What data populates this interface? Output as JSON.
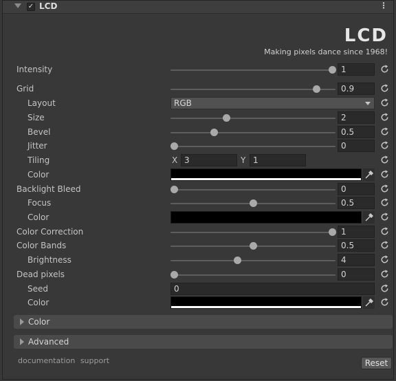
{
  "header": {
    "title": "LCD",
    "enabled_check": "✓",
    "menu_glyph": "⋮"
  },
  "logo": {
    "text": "LCD",
    "tagline": "Making pixels dance since 1968!"
  },
  "rows": [
    {
      "label": "Intensity",
      "value": "1",
      "fraction": 1.0
    },
    {
      "label": "Grid",
      "value": "0.9",
      "fraction": 0.9
    },
    {
      "label": "Layout",
      "value": "RGB"
    },
    {
      "label": "Size",
      "value": "2",
      "fraction": 0.33
    },
    {
      "label": "Bevel",
      "value": "0.5",
      "fraction": 0.25
    },
    {
      "label": "Jitter",
      "value": "0",
      "fraction": 0.0
    },
    {
      "label": "Tiling",
      "x_label": "X",
      "x_value": "3",
      "y_label": "Y",
      "y_value": "1"
    },
    {
      "label": "Color",
      "color": "#000000",
      "bar_color": "#ffffff"
    },
    {
      "label": "Backlight Bleed",
      "value": "0",
      "fraction": 0.0
    },
    {
      "label": "Focus",
      "value": "0.5",
      "fraction": 0.5
    },
    {
      "label": "Color",
      "color": "#000000",
      "bar_color": "#000000"
    },
    {
      "label": "Color Correction",
      "value": "1",
      "fraction": 1.0
    },
    {
      "label": "Color Bands",
      "value": "0.5",
      "fraction": 0.5
    },
    {
      "label": "Brightness",
      "value": "4",
      "fraction": 0.4
    },
    {
      "label": "Dead pixels",
      "value": "0",
      "fraction": 0.0
    },
    {
      "label": "Seed",
      "value": "0"
    },
    {
      "label": "Color",
      "color": "#000000",
      "bar_color": "#ffffff"
    }
  ],
  "foldouts": [
    {
      "label": "Color"
    },
    {
      "label": "Advanced"
    }
  ],
  "footer": {
    "documentation": "documentation",
    "support": "support",
    "reset": "Reset"
  },
  "colors": {
    "background": "#383838",
    "field": "#2a2a2a",
    "thumb": "#a9a9a9"
  },
  "icons": {
    "reset": "refresh-icon",
    "picker": "eyedropper-icon"
  }
}
